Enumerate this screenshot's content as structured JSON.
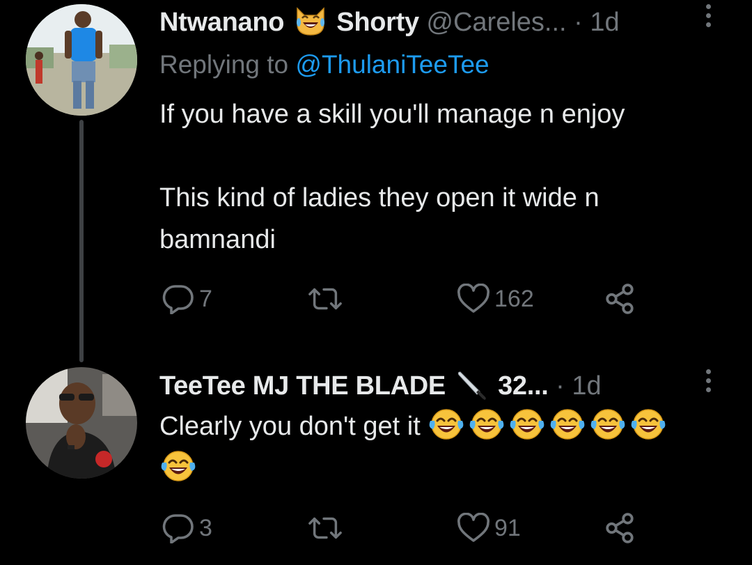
{
  "tweets": [
    {
      "author_name": "Ntwanano",
      "author_name_suffix": "Shorty",
      "name_emoji": "joy-cat",
      "handle": "@Careles...",
      "time": "1d",
      "replying_prefix": "Replying to",
      "replying_to": "@ThulaniTeeTee",
      "text_paragraphs": [
        "If you have a skill you'll manage n enjoy",
        "This kind of ladies they open it wide n bamnandi"
      ],
      "reply_count": "7",
      "retweet_count": "",
      "like_count": "162"
    },
    {
      "author_name": "TeeTee MJ THE BLADE",
      "name_emoji": "knife",
      "author_name_suffix": "32...",
      "time": "1d",
      "text": "Clearly you don't get it",
      "laugh_emoji_count": 7,
      "reply_count": "3",
      "retweet_count": "",
      "like_count": "91"
    }
  ],
  "colors": {
    "background": "#000000",
    "text_primary": "#e7e9ea",
    "text_secondary": "#71767b",
    "link": "#1d9bf0",
    "thread_line": "#3e4144"
  },
  "icons": [
    "more-icon",
    "reply-icon",
    "retweet-icon",
    "like-icon",
    "share-icon"
  ]
}
